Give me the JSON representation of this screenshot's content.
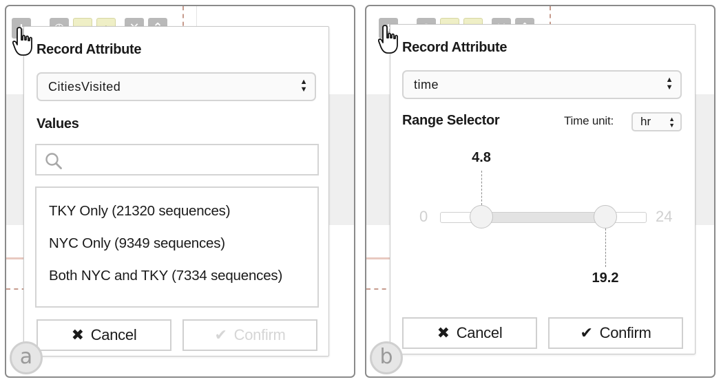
{
  "panel_a": {
    "badge": "a",
    "dialog_title": "Record Attribute",
    "attribute_select": "CitiesVisited",
    "values_label": "Values",
    "search_placeholder": "",
    "values": [
      "TKY Only (21320 sequences)",
      "NYC Only (9349 sequences)",
      "Both NYC and TKY (7334 sequences)"
    ],
    "cancel_label": "Cancel",
    "confirm_label": "Confirm",
    "confirm_enabled": false
  },
  "panel_b": {
    "badge": "b",
    "dialog_title": "Record Attribute",
    "attribute_select": "time",
    "range_label": "Range Selector",
    "time_unit_label": "Time unit:",
    "time_unit_value": "hr",
    "range_min": "0",
    "range_max": "24",
    "low_value": 4.8,
    "high_value": 19.2,
    "low_value_text": "4.8",
    "high_value_text": "19.2",
    "cancel_label": "Cancel",
    "confirm_label": "Confirm",
    "confirm_enabled": true
  },
  "icons": {
    "cancel": "✖",
    "confirm": "✔",
    "select_arrows": "up-down-arrows",
    "search": "magnifier-icon",
    "cursor": "hand-pointer-icon"
  },
  "colors": {
    "border": "#8a8a8a",
    "toolbar_yellow": "#efefc6",
    "disabled_text": "#d6d6d6"
  }
}
